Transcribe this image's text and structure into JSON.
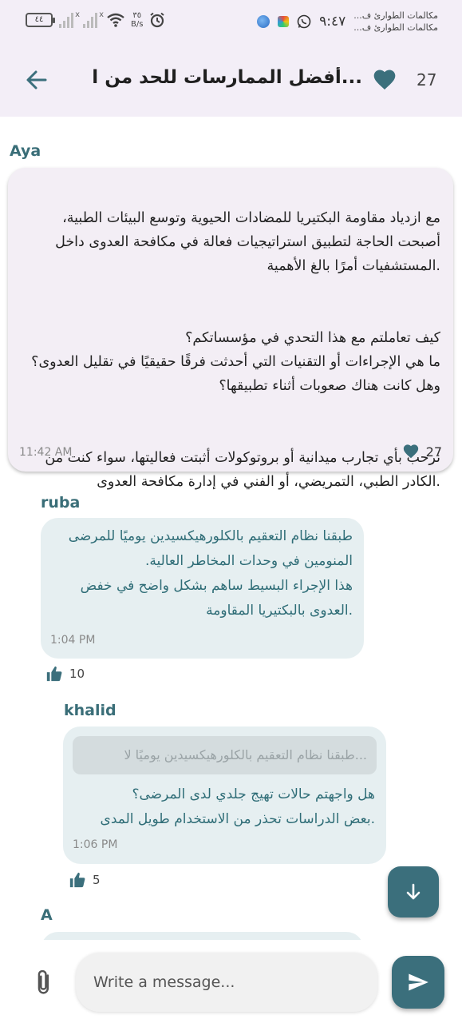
{
  "status_bar": {
    "battery": "٤٤",
    "speed_value": "٣٥",
    "speed_unit": "B/s",
    "time": "٩:٤٧",
    "notif_line1": "مكالمات الطوارئ ف...",
    "notif_line2": "مكالمات الطوارئ ف..."
  },
  "header": {
    "title": "...أفضل الممارسات للحد من ا",
    "likes_count": "27",
    "accent_color": "#3b6f7c"
  },
  "post": {
    "author": "Aya",
    "paragraphs": [
      "مع ازدياد مقاومة البكتيريا للمضادات الحيوية وتوسع البيئات الطبية، أصبحت الحاجة لتطبيق استراتيجيات فعالة في مكافحة العدوى داخل .المستشفيات أمرًا بالغ الأهمية",
      "كيف تعاملتم مع هذا التحدي في مؤسساتكم؟\nما هي الإجراءات أو التقنيات التي أحدثت فرقًا حقيقيًا في تقليل العدوى؟ وهل كانت هناك صعوبات أثناء تطبيقها؟",
      "نرحب بأي تجارب ميدانية أو بروتوكولات أثبتت فعاليتها، سواء كنت من .الكادر الطبي، التمريضي، أو الفني في إدارة مكافحة العدوى"
    ],
    "time": "11:42 AM",
    "likes": "27"
  },
  "replies": [
    {
      "author": "ruba",
      "text": "طبقنا نظام التعقيم بالكلورهيكسيدين يوميًا للمرضى المنومين في وحدات المخاطر العالية.\nهذا الإجراء البسيط ساهم بشكل واضح في خفض .العدوى بالبكتيريا المقاومة",
      "time": "1:04 PM",
      "likes": "10"
    },
    {
      "author": "khalid",
      "quote": "...طبقنا نظام التعقيم بالكلورهيكسيدين يوميًا لا",
      "text": "هل واجهتم حالات تهيج جلدي لدى المرضى؟\n.بعض الدراسات تحذر من الاستخدام طويل المدى",
      "time": "1:06 PM",
      "likes": "5"
    },
    {
      "author": "A"
    }
  ],
  "composer": {
    "placeholder": "Write a message..."
  }
}
